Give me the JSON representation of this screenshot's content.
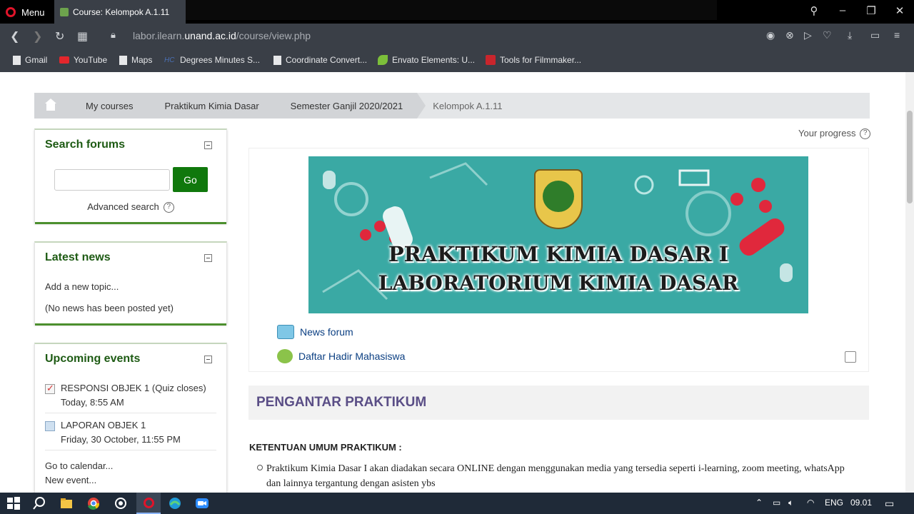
{
  "browser": {
    "menu_label": "Menu",
    "tab_title": "Course: Kelompok A.1.11",
    "url_prefix": "labor.ilearn.",
    "url_domain": "unand.ac.id",
    "url_path": "/course/view.php",
    "bookmarks": [
      {
        "label": "Gmail",
        "icon": "page-icon"
      },
      {
        "label": "YouTube",
        "icon": "youtube-icon"
      },
      {
        "label": "Maps",
        "icon": "page-icon"
      },
      {
        "label": "Degrees Minutes S...",
        "icon": "hc-icon"
      },
      {
        "label": "Coordinate Convert...",
        "icon": "page-icon"
      },
      {
        "label": "Envato Elements: U...",
        "icon": "leaf-icon"
      },
      {
        "label": "Tools for Filmmaker...",
        "icon": "red-logo-icon"
      }
    ]
  },
  "breadcrumb": {
    "items": [
      "My courses",
      "Praktikum Kimia Dasar",
      "Semester Ganjil 2020/2021",
      "Kelompok A.1.11"
    ]
  },
  "search_forums": {
    "title": "Search forums",
    "input_value": "",
    "go_label": "Go",
    "advanced_label": "Advanced search",
    "help_glyph": "?"
  },
  "latest_news": {
    "title": "Latest news",
    "add_topic": "Add a new topic...",
    "empty": "(No news has been posted yet)"
  },
  "upcoming_events": {
    "title": "Upcoming events",
    "events": [
      {
        "name": "RESPONSI OBJEK 1 (Quiz closes)",
        "date": "Today, 8:55 AM",
        "icon": "quiz-icon"
      },
      {
        "name": "LAPORAN OBJEK 1",
        "date": "Friday, 30 October, 11:55 PM",
        "icon": "assignment-icon"
      }
    ],
    "calendar_link": "Go to calendar...",
    "new_event_link": "New event..."
  },
  "course": {
    "progress_label": "Your progress",
    "banner_line1": "PRAKTIKUM KIMIA DASAR I",
    "banner_line2": "LABORATORIUM KIMIA DASAR",
    "modules": [
      {
        "label": "News forum",
        "icon": "forum-icon"
      },
      {
        "label": "Daftar Hadir Mahasiswa",
        "icon": "attendance-icon"
      }
    ],
    "section_title": "PENGANTAR PRAKTIKUM",
    "rules_heading": "KETENTUAN UMUM PRAKTIKUM :",
    "rule_1": "Praktikum Kimia Dasar I akan diadakan secara ONLINE dengan menggunakan media yang tersedia seperti i-learning, zoom meeting, whatsApp dan lainnya tergantung dengan asisten ybs"
  },
  "taskbar": {
    "language": "ENG",
    "time": "09.01"
  },
  "colors": {
    "block_title": "#1e5b14",
    "go_button": "#10780c",
    "section_title": "#5a4e86",
    "link": "#0b3f82"
  }
}
